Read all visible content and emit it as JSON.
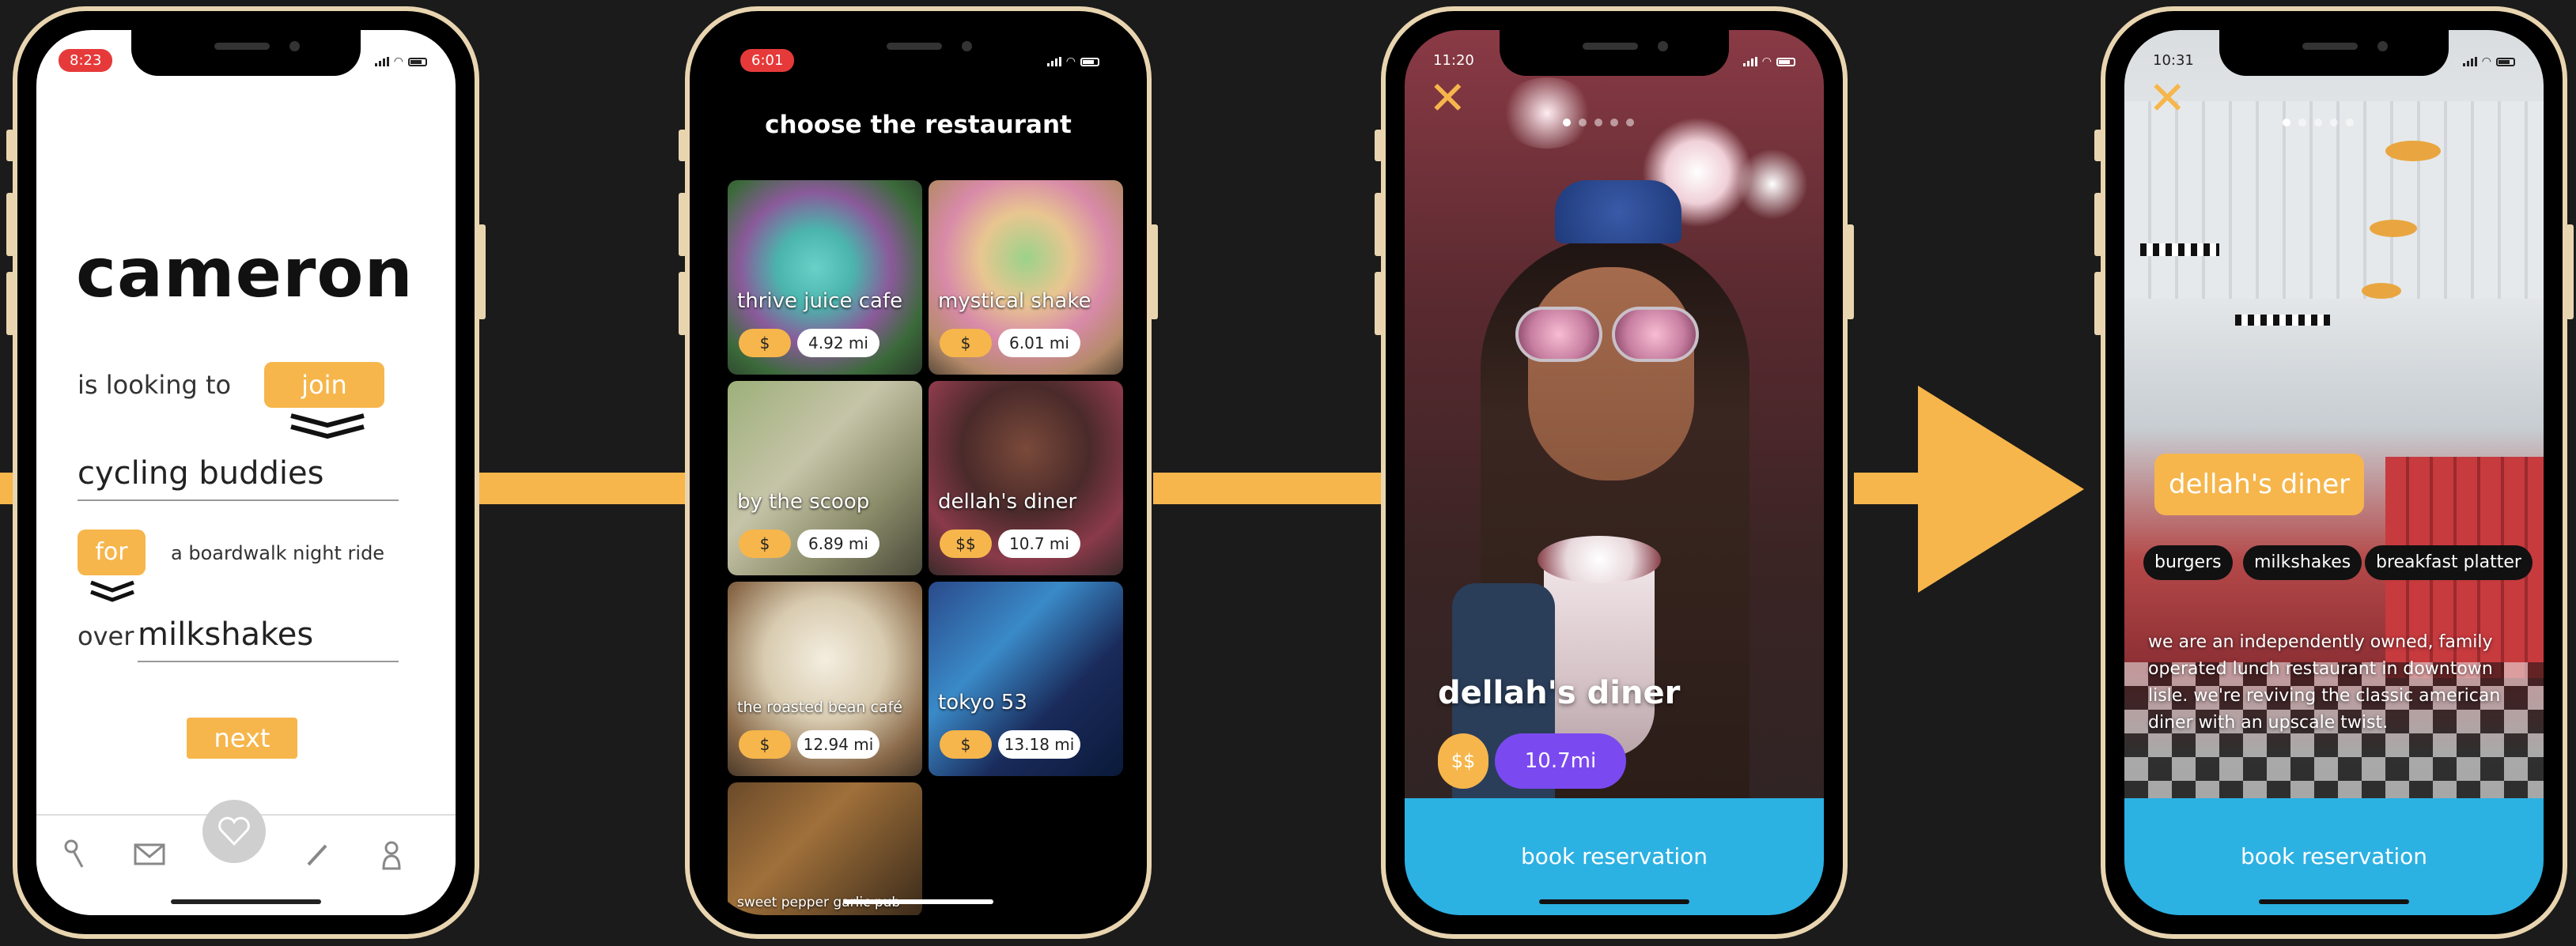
{
  "colors": {
    "accent": "#f6b64c",
    "purple": "#7b49f0",
    "cta_blue": "#2cb1e3",
    "background": "#1c1b1b"
  },
  "phone1": {
    "status_time": "8:23",
    "name": "cameron",
    "looking_to_label": "is looking to",
    "action_pill": "join",
    "activity_value": "cycling buddies",
    "for_pill": "for",
    "occasion": "a boardwalk night ride",
    "over_label": "over",
    "treat_value": "milkshakes",
    "next_button": "next",
    "tabs": [
      {
        "icon": "key-icon"
      },
      {
        "icon": "mail-icon"
      },
      {
        "icon": "heart-icon"
      },
      {
        "icon": "pencil-icon"
      },
      {
        "icon": "user-icon"
      }
    ]
  },
  "phone2": {
    "status_time": "6:01",
    "header": "choose the restaurant",
    "restaurants": [
      {
        "name": "thrive juice cafe",
        "price": "$",
        "distance": "4.92 mi"
      },
      {
        "name": "mystical shake",
        "price": "$",
        "distance": "6.01 mi"
      },
      {
        "name": "by the scoop",
        "price": "$",
        "distance": "6.89 mi"
      },
      {
        "name": "dellah's diner",
        "price": "$$",
        "distance": "10.7 mi"
      },
      {
        "name": "the roasted bean café",
        "price": "$",
        "distance": "12.94 mi"
      },
      {
        "name": "tokyo 53",
        "price": "$",
        "distance": "13.18 mi"
      },
      {
        "name": "sweet pepper garlic pub"
      }
    ]
  },
  "phone3": {
    "status_time": "11:20",
    "close_icon": "close-icon",
    "restaurant_name": "dellah's diner",
    "price": "$$",
    "distance": "10.7mi",
    "cta": "book reservation"
  },
  "phone4": {
    "status_time": "10:31",
    "close_icon": "close-icon",
    "restaurant_name": "dellah's diner",
    "tags": [
      "burgers",
      "milkshakes",
      "breakfast platter"
    ],
    "description": "we are an independently owned, family operated lunch restaurant in downtown lisle. we're reviving the classic american diner with an upscale twist.",
    "cta": "book reservation"
  }
}
